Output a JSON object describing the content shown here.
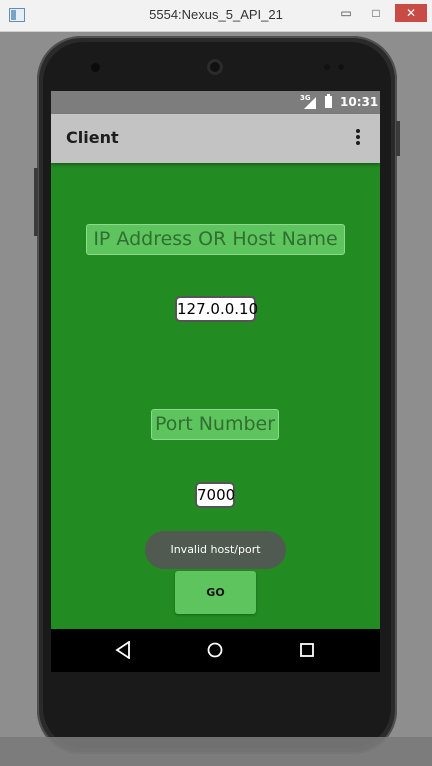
{
  "window": {
    "title": "5554:Nexus_5_API_21",
    "minimize_glyph": "▭",
    "maximize_glyph": "□",
    "close_glyph": "✕"
  },
  "status_bar": {
    "network": "3G",
    "time": "10:31"
  },
  "action_bar": {
    "title": "Client",
    "overflow_icon": "more-vert-icon"
  },
  "form": {
    "ip_label": "IP Address OR Host Name",
    "ip_value": "127.0.0.10",
    "port_label": "Port Number",
    "port_value": "7000",
    "go_button": "GO"
  },
  "toast": {
    "message": "Invalid host/port"
  },
  "nav_bar": {
    "back_icon": "back-icon",
    "home_icon": "home-icon",
    "recents_icon": "recents-icon"
  },
  "colors": {
    "background": "#228b22",
    "label_box": "#5ec45e",
    "action_bar": "#c3c3c3",
    "status_bar": "#7d7d7d",
    "toast": "#505a50"
  }
}
